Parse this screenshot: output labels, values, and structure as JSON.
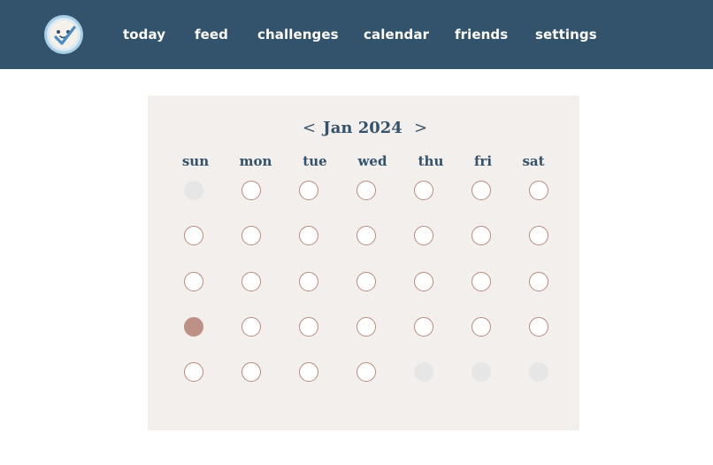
{
  "nav": {
    "logo_icon": "smiling-checkmark-icon",
    "links": [
      "today",
      "feed",
      "challenges",
      "calendar",
      "friends",
      "settings"
    ]
  },
  "calendar": {
    "prev_label": "<",
    "next_label": ">",
    "month_label": "Jan 2024",
    "weekdays": [
      "sun",
      "mon",
      "tue",
      "wed",
      "thu",
      "fri",
      "sat"
    ],
    "weeks": [
      [
        "empty",
        "open",
        "open",
        "open",
        "open",
        "open",
        "open"
      ],
      [
        "open",
        "open",
        "open",
        "open",
        "open",
        "open",
        "open"
      ],
      [
        "open",
        "open",
        "open",
        "open",
        "open",
        "open",
        "open"
      ],
      [
        "done",
        "open",
        "open",
        "open",
        "open",
        "open",
        "open"
      ],
      [
        "open",
        "open",
        "open",
        "open",
        "empty",
        "empty",
        "empty"
      ]
    ]
  },
  "colors": {
    "nav_background": "#33526b",
    "card_background": "#f3efec",
    "completed_day": "#bd9185",
    "day_outline": "#b58b7d",
    "empty_day": "#e6e6e6"
  }
}
